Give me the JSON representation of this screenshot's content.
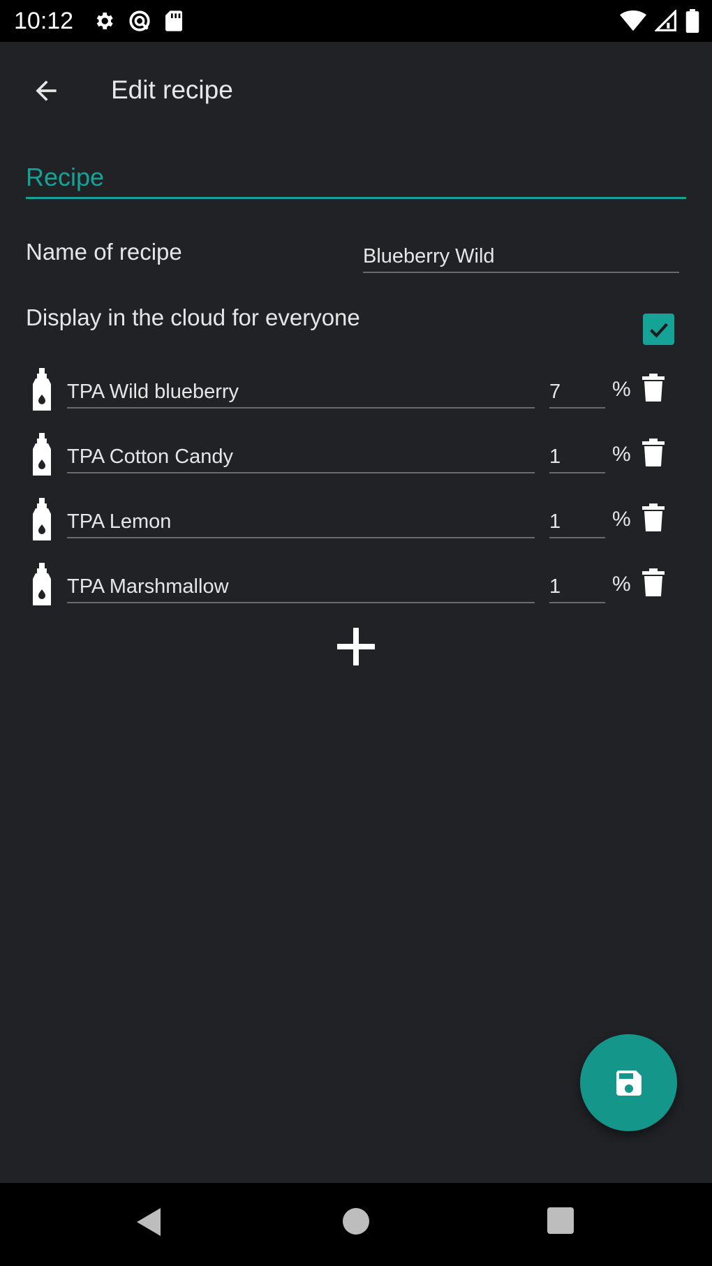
{
  "status_bar": {
    "time": "10:12",
    "left_icons": [
      "gear-icon",
      "vpn-icon",
      "sd-card-icon"
    ],
    "right_icons": [
      "wifi-icon",
      "signal-icon",
      "battery-icon"
    ]
  },
  "app_bar": {
    "title": "Edit recipe",
    "back_icon": "arrow-back-icon"
  },
  "section": {
    "title": "Recipe",
    "accent_color": "#14a396"
  },
  "form": {
    "name_label": "Name of recipe",
    "name_value": "Blueberry Wild",
    "cloud_label": "Display in the cloud for everyone",
    "cloud_checked": true
  },
  "ingredients": [
    {
      "name": "TPA Wild blueberry",
      "percent": "7",
      "unit": "%"
    },
    {
      "name": "TPA Cotton Candy",
      "percent": "1",
      "unit": "%"
    },
    {
      "name": "TPA Lemon",
      "percent": "1",
      "unit": "%"
    },
    {
      "name": "TPA Marshmallow",
      "percent": "1",
      "unit": "%"
    }
  ],
  "actions": {
    "add_icon": "plus-icon",
    "save_icon": "floppy-disk-icon",
    "fab_color": "#14968b"
  },
  "nav_bar": {
    "icons": [
      "nav-back-icon",
      "nav-home-icon",
      "nav-recents-icon"
    ]
  }
}
